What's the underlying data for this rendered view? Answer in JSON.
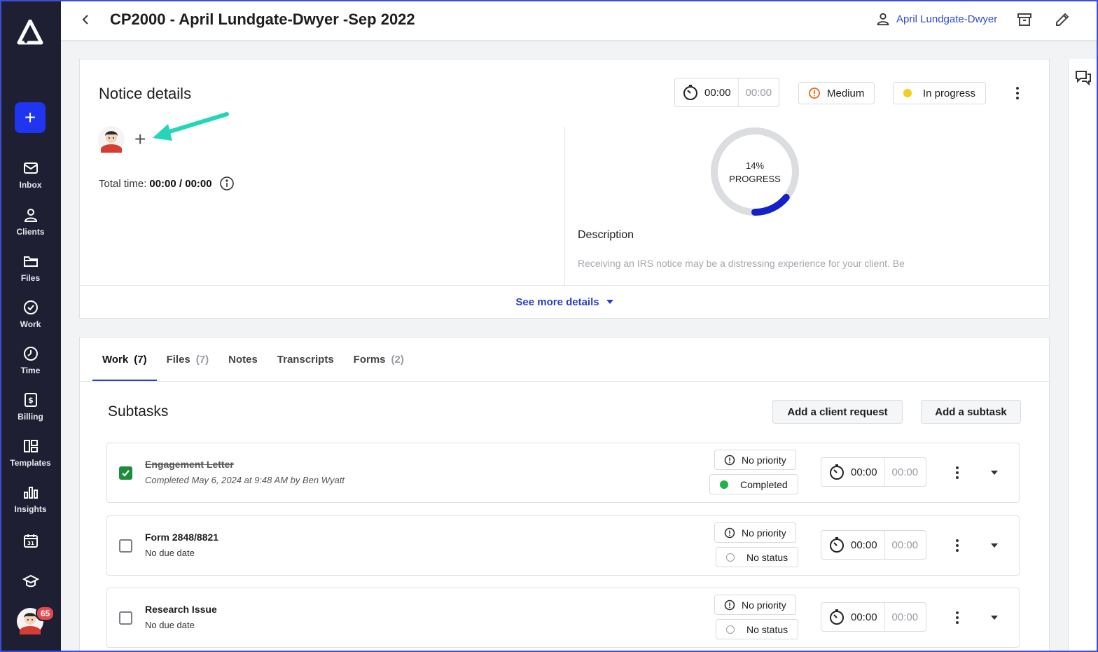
{
  "sidebar": {
    "new_button": "+",
    "items": [
      {
        "label": "Inbox",
        "icon": "mail-icon"
      },
      {
        "label": "Clients",
        "icon": "clients-icon"
      },
      {
        "label": "Files",
        "icon": "folder-icon"
      },
      {
        "label": "Work",
        "icon": "check-circle-icon"
      },
      {
        "label": "Time",
        "icon": "timer-icon"
      },
      {
        "label": "Billing",
        "icon": "billing-icon"
      },
      {
        "label": "Templates",
        "icon": "templates-icon"
      },
      {
        "label": "Insights",
        "icon": "insights-icon"
      }
    ],
    "notification_count": "65"
  },
  "header": {
    "title": "CP2000 - April Lundgate-Dwyer -Sep 2022",
    "client_name": "April Lundgate-Dwyer"
  },
  "notice": {
    "heading": "Notice details",
    "add_assignee": "+",
    "total_time_label": "Total time:",
    "total_time_value": "00:00 / 00:00",
    "timer_tracked": "00:00",
    "timer_estimate": "00:00",
    "priority": "Medium",
    "status": "In progress",
    "progress_percent": 14,
    "progress_label_percent": "14%",
    "progress_label": "PROGRESS",
    "description_heading": "Description",
    "description_text": "Receiving an IRS notice may be a distressing experience for your client. Be",
    "see_more": "See more details"
  },
  "colors": {
    "accent": "#1f35f0",
    "priority_medium": "#e8742b",
    "status_in_progress": "#f2cf1b",
    "status_completed": "#1fb24a",
    "progress_fill": "#1421c9",
    "progress_track": "#dcdde0",
    "arrow": "#23d6b8"
  },
  "work": {
    "tabs": [
      {
        "label": "Work",
        "count": "(7)"
      },
      {
        "label": "Files",
        "count": "(7)"
      },
      {
        "label": "Notes",
        "count": ""
      },
      {
        "label": "Transcripts",
        "count": ""
      },
      {
        "label": "Forms",
        "count": "(2)"
      }
    ],
    "subtasks_heading": "Subtasks",
    "add_client_request": "Add a client request",
    "add_subtask": "Add a subtask",
    "rows": [
      {
        "title": "Engagement Letter",
        "subtitle": "Completed May 6, 2024 at 9:48 AM by Ben Wyatt",
        "priority": "No priority",
        "status": "Completed",
        "tracked": "00:00",
        "estimate": "00:00",
        "checked": true
      },
      {
        "title": "Form 2848/8821",
        "subtitle": "No due date",
        "priority": "No priority",
        "status": "No status",
        "tracked": "00:00",
        "estimate": "00:00",
        "checked": false
      },
      {
        "title": "Research Issue",
        "subtitle": "No due date",
        "priority": "No priority",
        "status": "No status",
        "tracked": "00:00",
        "estimate": "00:00",
        "checked": false
      }
    ]
  }
}
